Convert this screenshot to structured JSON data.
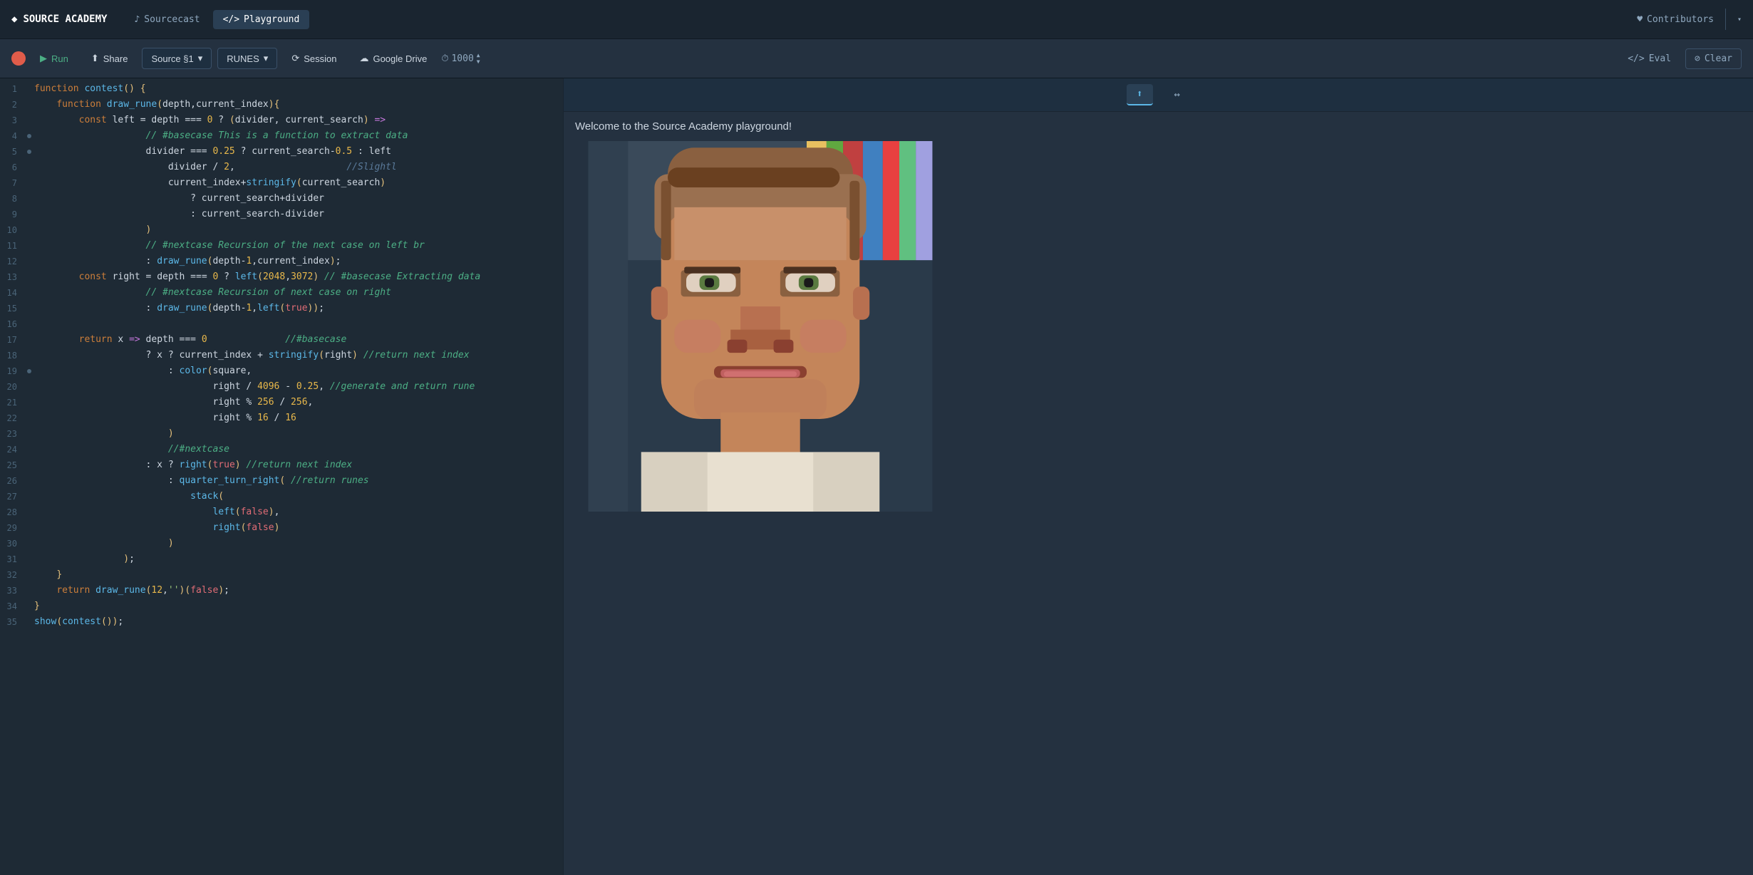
{
  "nav": {
    "logo_diamond": "◆",
    "logo_text": "SOURCE ACADEMY",
    "tab_sourcecast": "Sourcecast",
    "tab_playground": "Playground",
    "tab_sourcecast_icon": "♪",
    "tab_playground_icon": "</>",
    "contributors_label": "Contributors",
    "contributors_icon": "♥",
    "dropdown_arrow": "▾"
  },
  "toolbar": {
    "run_label": "Run",
    "share_label": "Share",
    "source_label": "Source §1",
    "runes_label": "RUNES",
    "session_label": "Session",
    "gdrive_label": "Google Drive",
    "steps_value": "1000",
    "eval_label": "Eval",
    "clear_label": "Clear"
  },
  "editor": {
    "lines": [
      {
        "num": 1,
        "dot": false,
        "content": "function contest() {"
      },
      {
        "num": 2,
        "dot": false,
        "content": "    function draw_rune(depth,current_index){"
      },
      {
        "num": 3,
        "dot": false,
        "content": "        const left = depth === 0 ? (divider, current_search) =>"
      },
      {
        "num": 4,
        "dot": true,
        "content": "                    // #basecase This is a function to extract data"
      },
      {
        "num": 5,
        "dot": true,
        "content": "                    divider === 0.25 ? current_search-0.5 : left"
      },
      {
        "num": 6,
        "dot": false,
        "content": "                        divider / 2,                    //Slightl"
      },
      {
        "num": 7,
        "dot": false,
        "content": "                        current_index+stringify(current_search) "
      },
      {
        "num": 8,
        "dot": false,
        "content": "                            ? current_search+divider"
      },
      {
        "num": 9,
        "dot": false,
        "content": "                            : current_search-divider"
      },
      {
        "num": 10,
        "dot": false,
        "content": "                    )"
      },
      {
        "num": 11,
        "dot": false,
        "content": "                    // #nextcase Recursion of the next case on left br"
      },
      {
        "num": 12,
        "dot": false,
        "content": "                    : draw_rune(depth-1,current_index);"
      },
      {
        "num": 13,
        "dot": false,
        "content": "        const right = depth === 0 ? left(2048,3072) // #basecase Extracting data"
      },
      {
        "num": 14,
        "dot": false,
        "content": "                    // #nextcase Recursion of next case on right"
      },
      {
        "num": 15,
        "dot": false,
        "content": "                    : draw_rune(depth-1,left(true));"
      },
      {
        "num": 16,
        "dot": false,
        "content": ""
      },
      {
        "num": 17,
        "dot": false,
        "content": "        return x => depth === 0                //#basecase"
      },
      {
        "num": 18,
        "dot": false,
        "content": "                    ? x ? current_index + stringify(right) //return next index"
      },
      {
        "num": 19,
        "dot": true,
        "content": "                        : color(square,"
      },
      {
        "num": 20,
        "dot": false,
        "content": "                                right / 4096 - 0.25, //generate and return rune"
      },
      {
        "num": 21,
        "dot": false,
        "content": "                                right % 256 / 256,"
      },
      {
        "num": 22,
        "dot": false,
        "content": "                                right % 16 / 16"
      },
      {
        "num": 23,
        "dot": false,
        "content": "                        )"
      },
      {
        "num": 24,
        "dot": false,
        "content": "                        //#nextcase"
      },
      {
        "num": 25,
        "dot": false,
        "content": "                    : x ? right(true) //return next index"
      },
      {
        "num": 26,
        "dot": false,
        "content": "                        : quarter_turn_right( //return runes"
      },
      {
        "num": 27,
        "dot": false,
        "content": "                            stack("
      },
      {
        "num": 28,
        "dot": false,
        "content": "                                left(false),"
      },
      {
        "num": 29,
        "dot": false,
        "content": "                                right(false)"
      },
      {
        "num": 30,
        "dot": false,
        "content": "                        )"
      },
      {
        "num": 31,
        "dot": false,
        "content": "                );"
      },
      {
        "num": 32,
        "dot": false,
        "content": "    }"
      },
      {
        "num": 33,
        "dot": false,
        "content": "    return draw_rune(12,'')(false);"
      },
      {
        "num": 34,
        "dot": false,
        "content": "}"
      },
      {
        "num": 35,
        "dot": false,
        "content": "show(contest());"
      }
    ]
  },
  "right_panel": {
    "tab_output_icon": "⬆",
    "tab_link_icon": "↔",
    "welcome_text": "Welcome to the Source Academy playground!",
    "image_alt": "Pixelated face image"
  }
}
